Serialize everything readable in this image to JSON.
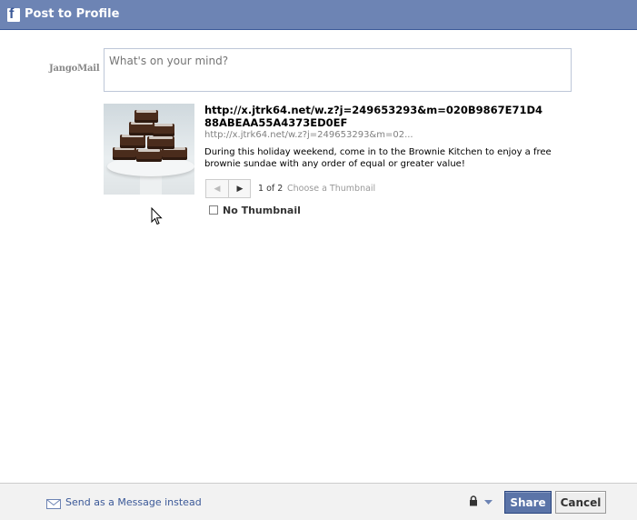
{
  "header": {
    "title": "Post to Profile",
    "logo_letter": "f"
  },
  "brand": {
    "name": "JangoMail"
  },
  "composer": {
    "placeholder": "What's on your mind?"
  },
  "attachment": {
    "title": "http://x.jtrk64.net/w.z?j=249653293&m=020B9867E71D488ABEAA55A4373ED0EF",
    "url": "http://x.jtrk64.net/w.z?j=249653293&m=02...",
    "description": "During this holiday weekend, come in to the Brownie Kitchen to enjoy a free brownie sundae with any order of equal or greater value!",
    "thumbnail_pager": {
      "prev_icon": "◀",
      "next_icon": "▶",
      "count": "1 of 2",
      "label": "Choose a Thumbnail"
    },
    "no_thumbnail": {
      "label": "No Thumbnail",
      "checked": false
    }
  },
  "footer": {
    "send_message_label": "Send as a Message instead",
    "share_label": "Share",
    "cancel_label": "Cancel",
    "privacy_icon": "lock-icon"
  },
  "colors": {
    "header_bg": "#6d84b4",
    "link": "#3b5998",
    "share_bg": "#5b74a8"
  }
}
